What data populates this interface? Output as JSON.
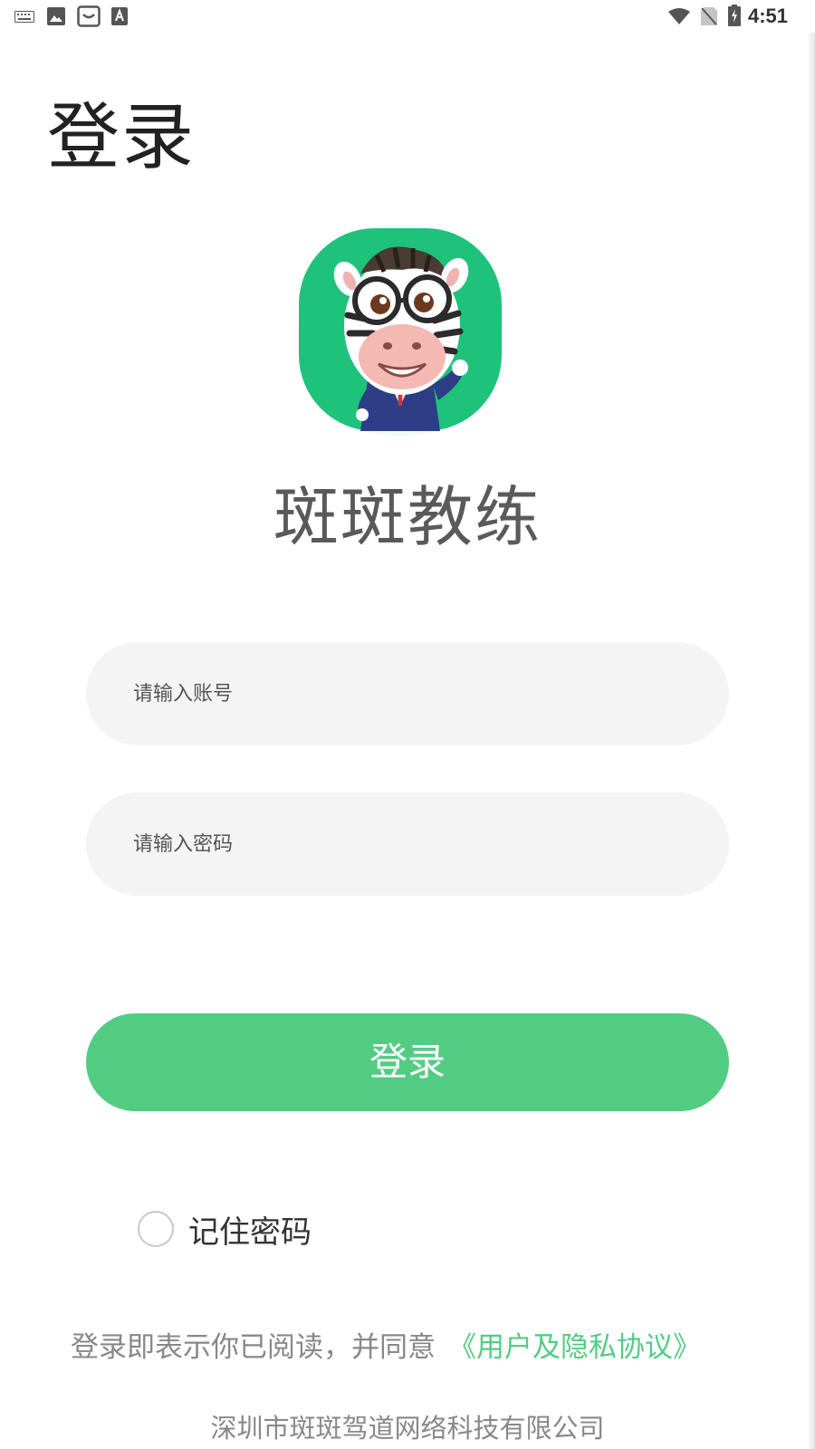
{
  "status_bar": {
    "time": "4:51",
    "icons": [
      "keyboard-icon",
      "image-icon",
      "store-bag-icon",
      "a-square-icon",
      "wifi-icon",
      "no-sim-icon",
      "battery-charging-icon"
    ]
  },
  "header": {
    "title": "登录"
  },
  "app": {
    "logo_icon": "zebra-mascot-logo",
    "name": "斑斑教练"
  },
  "form": {
    "account_placeholder": "请输入账号",
    "account_value": "",
    "password_placeholder": "请输入密码",
    "password_value": "",
    "login_label": "登录",
    "remember_label": "记住密码",
    "remember_checked": false
  },
  "footer": {
    "agreement_text": "登录即表示你已阅读，并同意",
    "agreement_link": "《用户及隐私协议》",
    "company": "深圳市斑斑驾道网络科技有限公司"
  },
  "colors": {
    "accent": "#53cc83",
    "input_bg": "#f4f4f4",
    "logo_bg": "#1fc27a",
    "text_dark": "#222222",
    "text_gray": "#888888"
  }
}
